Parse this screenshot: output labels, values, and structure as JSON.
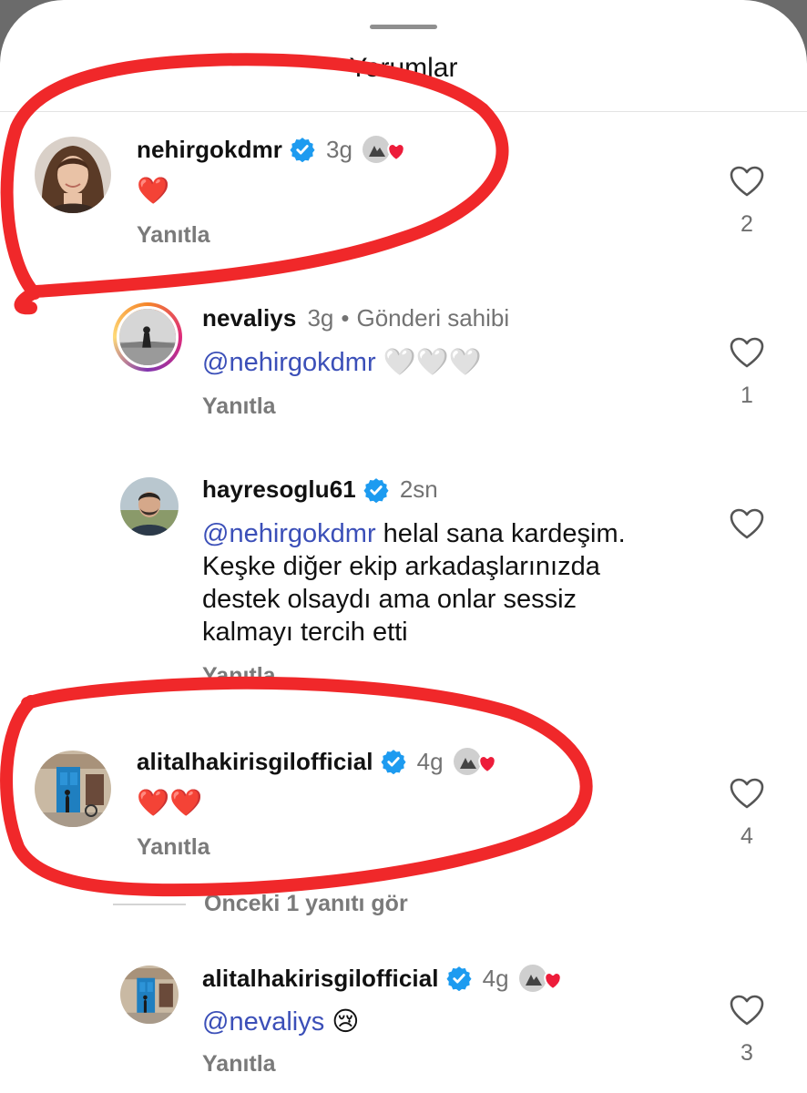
{
  "header": {
    "title": "Yorumlar"
  },
  "comments": [
    {
      "username": "nehirgokdmr",
      "verified": true,
      "time": "3g",
      "creator_liked": true,
      "text": "❤️",
      "reply_label": "Yanıtla",
      "like_count": "2",
      "avatar": "portrait-woman-long-hair"
    },
    {
      "username": "nevaliys",
      "verified": false,
      "time": "3g",
      "owner_label": "Gönderi sahibi",
      "mention": "@nehirgokdmr",
      "text": "🤍🤍🤍",
      "reply_label": "Yanıtla",
      "like_count": "1",
      "avatar": "landscape-person-story-ring"
    },
    {
      "username": "hayresoglu61",
      "verified": true,
      "time": "2sn",
      "mention": "@nehirgokdmr",
      "text_lines": [
        " helal sana kardeşim.",
        "Keşke diğer ekip arkadaşlarınızda",
        "destek olsaydı ama onlar sessiz",
        "kalmayı tercih etti"
      ],
      "reply_label": "Yanıtla",
      "like_count": "",
      "avatar": "portrait-man"
    },
    {
      "username": "alitalhakirisgilofficial",
      "verified": true,
      "time": "4g",
      "creator_liked": true,
      "text": "❤️❤️",
      "reply_label": "Yanıtla",
      "like_count": "4",
      "avatar": "blue-door-street"
    },
    {
      "username": "alitalhakirisgilofficial",
      "verified": true,
      "time": "4g",
      "creator_liked": true,
      "mention": "@nevaliys",
      "text": " 😢",
      "reply_label": "Yanıtla",
      "like_count": "3",
      "avatar": "blue-door-street"
    }
  ],
  "more_replies": {
    "label": "Önceki 1 yanıtı gör"
  },
  "colors": {
    "mention": "#3b4fb8",
    "verified": "#1d9bf0",
    "markup_red": "#f0282a",
    "muted": "#737373"
  },
  "icons": [
    "heart-outline-icon",
    "verified-badge-icon",
    "creator-liked-heart-icon"
  ]
}
